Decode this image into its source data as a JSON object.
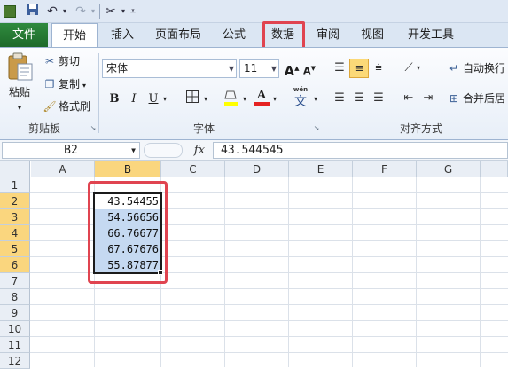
{
  "quick_access": {
    "icons": [
      "save-icon",
      "undo-icon",
      "redo-icon",
      "customize-icon"
    ]
  },
  "tabs": [
    {
      "label": "文件"
    },
    {
      "label": "开始"
    },
    {
      "label": "插入"
    },
    {
      "label": "页面布局"
    },
    {
      "label": "公式"
    },
    {
      "label": "数据"
    },
    {
      "label": "审阅"
    },
    {
      "label": "视图"
    },
    {
      "label": "开发工具"
    }
  ],
  "clipboard": {
    "paste": "粘贴",
    "cut": "剪切",
    "copy": "复制",
    "format_painter": "格式刷",
    "group_label": "剪贴板"
  },
  "font": {
    "family": "宋体",
    "size": "11",
    "grow": "A",
    "shrink": "A",
    "bold": "B",
    "italic": "I",
    "underline": "U",
    "font_color_glyph": "A",
    "phonetic": "wén",
    "phonetic_char": "文",
    "group_label": "字体"
  },
  "alignment": {
    "wrap_text": "自动换行",
    "merge_center": "合并后居",
    "group_label": "对齐方式"
  },
  "formula_bar": {
    "name_box": "B2",
    "fx": "fx",
    "formula": "43.544545"
  },
  "sheet": {
    "columns": [
      "A",
      "B",
      "C",
      "D",
      "E",
      "F",
      "G"
    ],
    "rows": [
      "1",
      "2",
      "3",
      "4",
      "5",
      "6",
      "7",
      "8",
      "9",
      "10",
      "11",
      "12"
    ],
    "selected_column": "B",
    "values": [
      "43.54455",
      "54.56656",
      "66.76677",
      "67.67676",
      "55.87877"
    ]
  },
  "colors": {
    "accent_red": "#e04450",
    "selection_blue": "#c5d9f1",
    "header_highlight": "#fad67e",
    "file_tab_green": "#1e6a2a"
  }
}
